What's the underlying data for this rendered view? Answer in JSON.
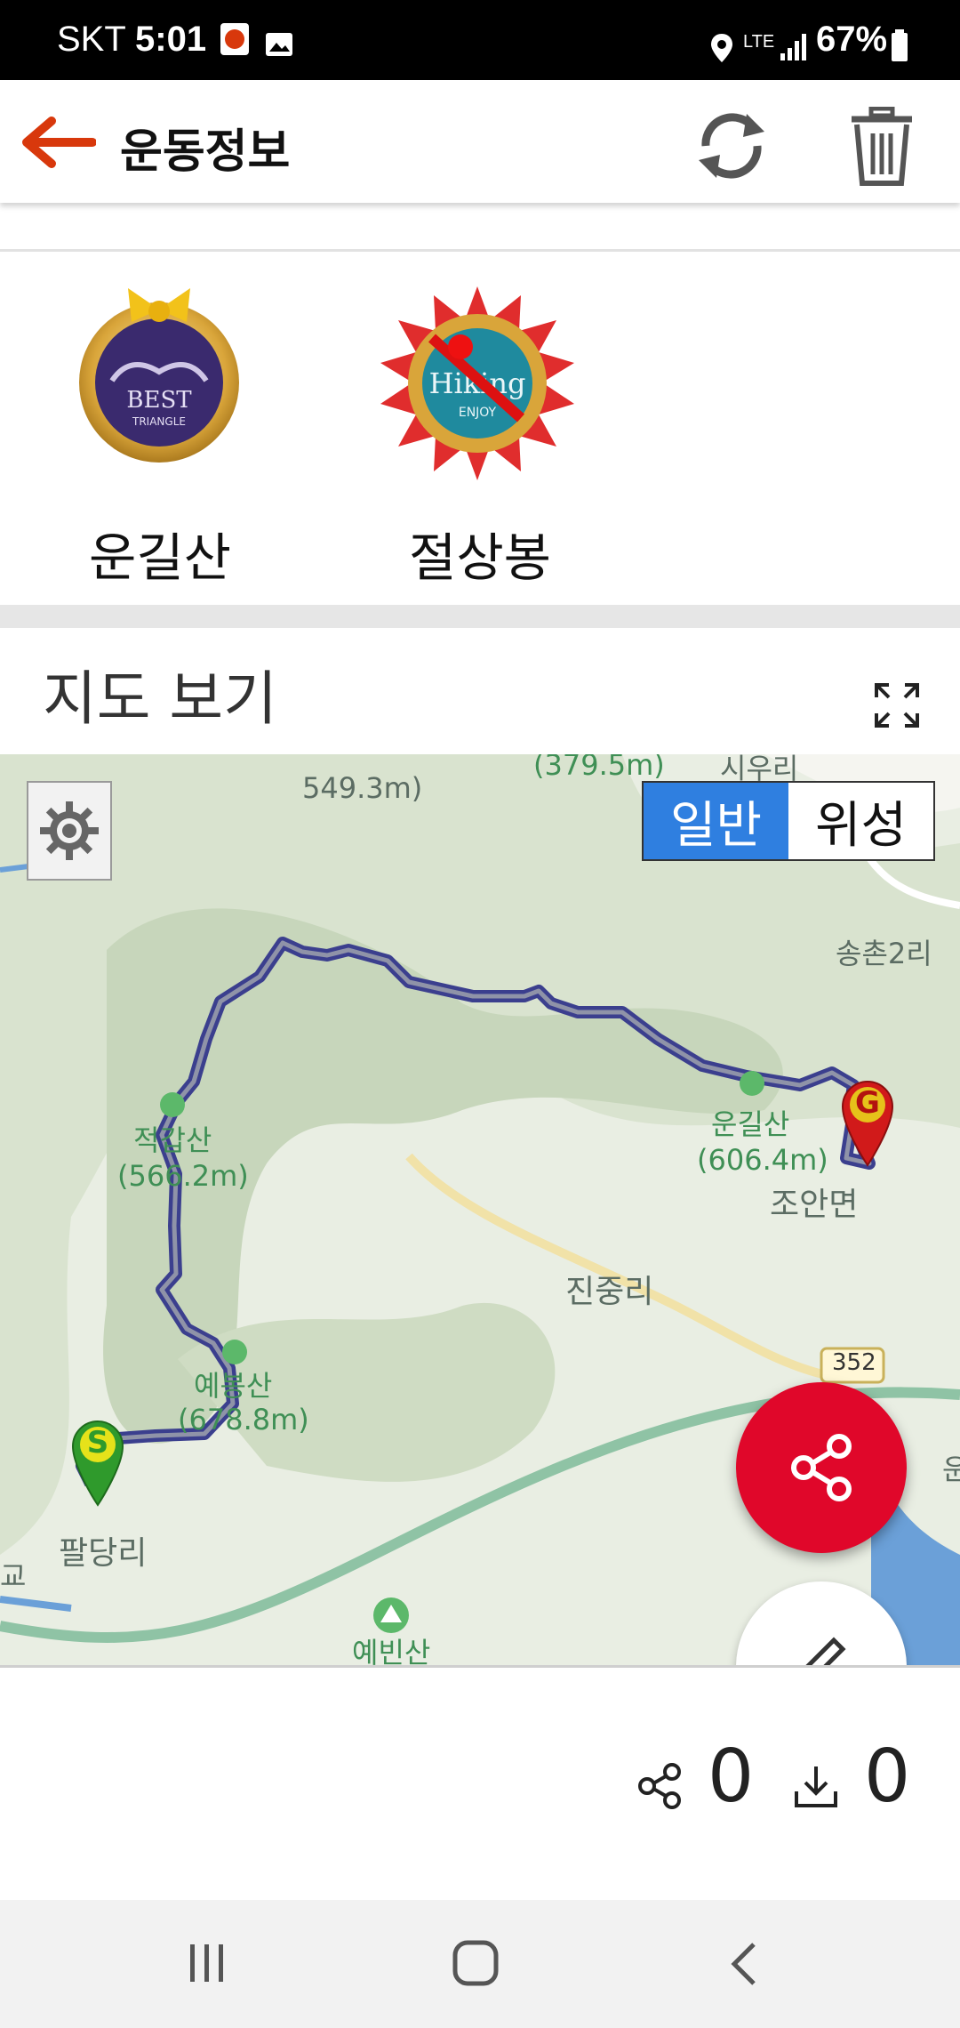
{
  "status_bar": {
    "carrier": "SKT",
    "time": "5:01",
    "network": "LTE",
    "battery": "67%"
  },
  "app_bar": {
    "title": "운동정보",
    "icons": [
      "back-arrow-icon",
      "refresh-icon",
      "trash-icon"
    ],
    "accent_color": "#d8380c"
  },
  "badges": [
    {
      "label": "운길산",
      "icon": "best-triangle-badge-icon",
      "badge_text": "BEST TRIANGLE"
    },
    {
      "label": "절상봉",
      "icon": "hiking-enjoy-badge-icon",
      "badge_text": "Hiking ENJOY"
    }
  ],
  "map_section": {
    "title": "지도 보기",
    "map_type_tabs": {
      "normal": "일반",
      "satellite": "위성",
      "selected": "일반"
    },
    "labels": {
      "peak_top_left": "549.3m)",
      "peak_top_mid": "(379.5m)",
      "village_top_right": "시우리",
      "village_songchon": "송촌2리",
      "peak_jeokgap": "적갑산",
      "peak_jeokgap_height": "(566.2m)",
      "peak_ungil": "운길산",
      "peak_ungil_height": "(606.4m)",
      "joan": "조안면",
      "jinjung": "진중리",
      "road_number": "352",
      "peak_yebong": "예봉산",
      "peak_yebong_height": "(678.8m)",
      "paldang": "팔당리",
      "yebin": "예빈산",
      "edge_left": "교",
      "edge_right": "운"
    },
    "markers": {
      "start": "S",
      "goal": "G"
    },
    "track_color": "#3b3f8e"
  },
  "stats": {
    "share_count": "0",
    "download_count": "0"
  }
}
